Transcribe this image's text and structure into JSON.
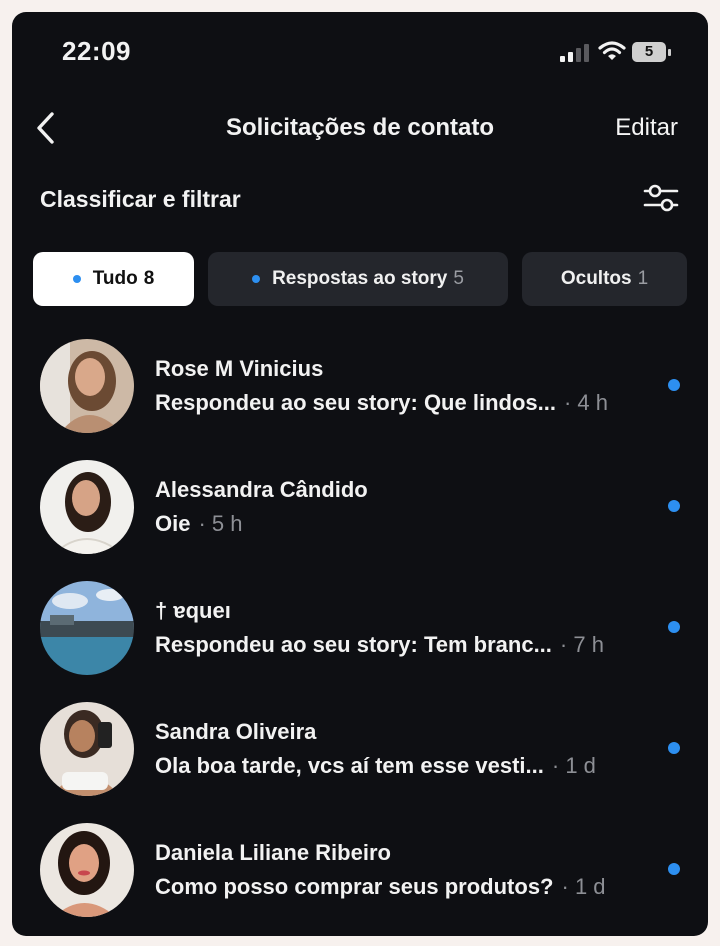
{
  "status_bar": {
    "time": "22:09",
    "battery": "5"
  },
  "header": {
    "title": "Solicitações de contato",
    "edit_label": "Editar"
  },
  "filter": {
    "label": "Classificar e filtrar"
  },
  "tabs": [
    {
      "label": "Tudo",
      "count": "8",
      "active": true
    },
    {
      "label": "Respostas ao story",
      "count": "5",
      "active": false
    },
    {
      "label": "Ocultos",
      "count": "1",
      "active": false
    }
  ],
  "requests": [
    {
      "name": "Rose M Vinicius",
      "preview": "Respondeu ao seu story: Que lindos...",
      "time": "· 4 h",
      "unread": true
    },
    {
      "name": "Alessandra Cândido",
      "preview": "Oie",
      "time": "· 5 h",
      "unread": true
    },
    {
      "name": "†      ɐqueı",
      "preview": "Respondeu ao seu story: Tem branc...",
      "time": "· 7 h",
      "unread": true
    },
    {
      "name": "Sandra Oliveira",
      "preview": "Ola boa tarde, vcs aí tem esse vesti...",
      "time": "· 1 d",
      "unread": true
    },
    {
      "name": "Daniela Liliane Ribeiro",
      "preview": "Como posso comprar seus produtos?",
      "time": "· 1 d",
      "unread": true
    }
  ],
  "colors": {
    "background": "#0e0f13",
    "accent_dot": "#2d8ff0",
    "chip_inactive": "#24262c",
    "chip_active": "#ffffff"
  }
}
